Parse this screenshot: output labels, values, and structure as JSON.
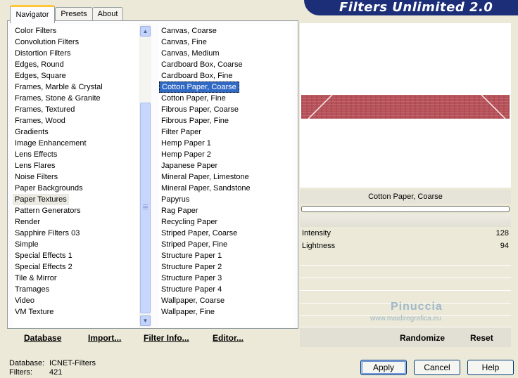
{
  "tabs": [
    {
      "label": "Navigator",
      "active": true
    },
    {
      "label": "Presets",
      "active": false
    },
    {
      "label": "About",
      "active": false
    }
  ],
  "title": "Filters Unlimited 2.0",
  "categories": {
    "selected": "Paper Textures",
    "items": [
      "Color Filters",
      "Convolution Filters",
      "Distortion Filters",
      "Edges, Round",
      "Edges, Square",
      "Frames, Marble & Crystal",
      "Frames, Stone & Granite",
      "Frames, Textured",
      "Frames, Wood",
      "Gradients",
      "Image Enhancement",
      "Lens Effects",
      "Lens Flares",
      "Noise Filters",
      "Paper Backgrounds",
      "Paper Textures",
      "Pattern Generators",
      "Render",
      "Sapphire Filters 03",
      "Simple",
      "Special Effects 1",
      "Special Effects 2",
      "Tile & Mirror",
      "Tramages",
      "Video",
      "VM Texture"
    ]
  },
  "filters": {
    "selected": "Cotton Paper, Coarse",
    "items": [
      "Canvas, Coarse",
      "Canvas, Fine",
      "Canvas, Medium",
      "Cardboard Box, Coarse",
      "Cardboard Box, Fine",
      "Cotton Paper, Coarse",
      "Cotton Paper, Fine",
      "Fibrous Paper, Coarse",
      "Fibrous Paper, Fine",
      "Filter Paper",
      "Hemp Paper 1",
      "Hemp Paper 2",
      "Japanese Paper",
      "Mineral Paper, Limestone",
      "Mineral Paper, Sandstone",
      "Papyrus",
      "Rag Paper",
      "Recycling Paper",
      "Striped Paper, Coarse",
      "Striped Paper, Fine",
      "Structure Paper 1",
      "Structure Paper 2",
      "Structure Paper 3",
      "Structure Paper 4",
      "Wallpaper, Coarse",
      "Wallpaper, Fine"
    ]
  },
  "preview": {
    "filter_name": "Cotton Paper, Coarse",
    "texture_color": "#b8525a"
  },
  "params": [
    {
      "label": "Intensity",
      "value": "128"
    },
    {
      "label": "Lightness",
      "value": "94"
    }
  ],
  "watermark": {
    "name": "Pinuccia",
    "url": "www.maidiregrafica.eu"
  },
  "left_buttons": {
    "database": "Database",
    "import": "Import...",
    "filter_info": "Filter Info...",
    "editor": "Editor..."
  },
  "right_buttons": {
    "randomize": "Randomize",
    "reset": "Reset"
  },
  "status": {
    "database_label": "Database:",
    "database_value": "ICNET-Filters",
    "filters_label": "Filters:",
    "filters_value": "421"
  },
  "dialog_buttons": {
    "apply": "Apply",
    "cancel": "Cancel",
    "help": "Help"
  },
  "icons": {
    "scroll_up": "scroll-up-icon",
    "scroll_down": "scroll-down-icon"
  }
}
